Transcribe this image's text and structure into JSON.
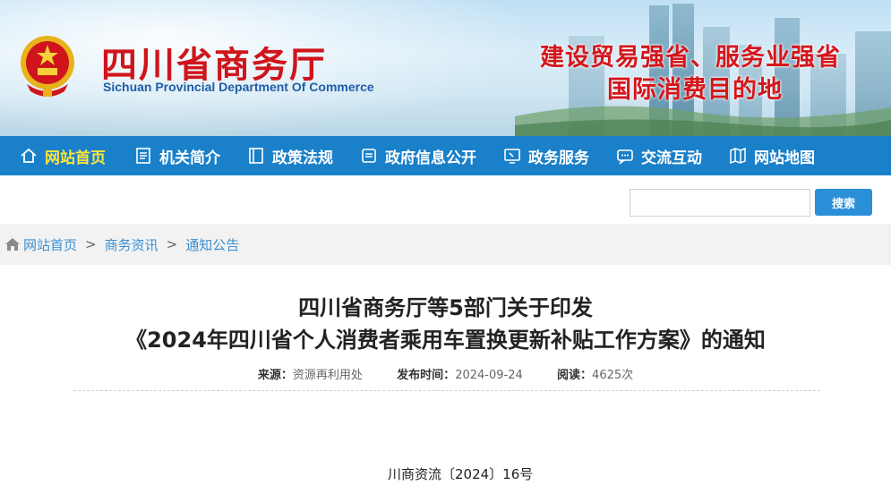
{
  "header": {
    "title_cn": "四川省商务厅",
    "title_en": "Sichuan Provincial Department Of Commerce",
    "slogan_line1": "建设贸易强省、服务业强省",
    "slogan_line2": "国际消费目的地",
    "emblem_icon": "national-emblem-icon"
  },
  "nav": {
    "items": [
      {
        "label": "网站首页",
        "icon": "home-icon",
        "active": true
      },
      {
        "label": "机关简介",
        "icon": "document-list-icon"
      },
      {
        "label": "政策法规",
        "icon": "book-icon"
      },
      {
        "label": "政府信息公开",
        "icon": "open-book-icon"
      },
      {
        "label": "政务服务",
        "icon": "monitor-icon"
      },
      {
        "label": "交流互动",
        "icon": "chat-icon"
      },
      {
        "label": "网站地图",
        "icon": "map-icon"
      }
    ]
  },
  "search": {
    "placeholder": "",
    "button_label": "搜索"
  },
  "breadcrumb": {
    "items": [
      "网站首页",
      "商务资讯",
      "通知公告"
    ],
    "separator": ">"
  },
  "article": {
    "title_line1": "四川省商务厅等5部门关于印发",
    "title_line2": "《2024年四川省个人消费者乘用车置换更新补贴工作方案》的通知",
    "source_label": "来源：",
    "source_value": "资源再利用处",
    "date_label": "发布时间：",
    "date_value": "2024-09-24",
    "views_label": "阅读：",
    "views_value": "4625次",
    "doc_number": "川商资流〔2024〕16号"
  },
  "colors": {
    "nav_bg": "#1a80c9",
    "nav_active": "#ffe43a",
    "title_red": "#d0141b",
    "link_blue": "#3a8fd1",
    "button_blue": "#2b8fd8"
  }
}
